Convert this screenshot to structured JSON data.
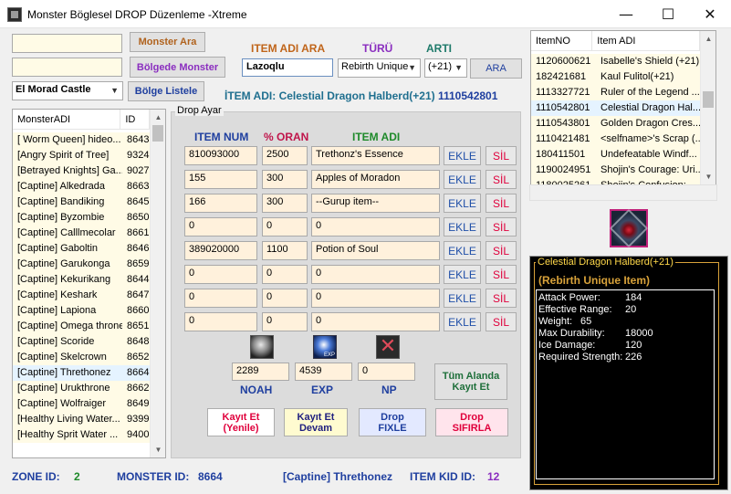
{
  "window": {
    "title": "Monster Böglesel DROP Düzenleme -Xtreme",
    "minimize": "—",
    "maximize": "☐",
    "close": "✕"
  },
  "search": {
    "input1": "",
    "input2": "",
    "monster_ara": "Monster Ara",
    "bolgede_monster": "Bölgede Monster",
    "zone_select": "El Morad Castle",
    "bolge_listele": "Bölge Listele"
  },
  "item_search": {
    "label": "ITEM ADI ARA",
    "value": "Lazoqlu",
    "turu_label": "TÜRÜ",
    "turu_value": "Rebirth Unique",
    "arti_label": "ARTI",
    "arti_value": "(+21)",
    "ara_button": "ARA"
  },
  "item_name_line": {
    "prefix": "İTEM ADI:",
    "name": "Celestial Dragon Halberd(+21)",
    "id": "1110542801"
  },
  "monster_list": {
    "headers": [
      "MonsterADI",
      "ID"
    ],
    "rows": [
      [
        "[ Worm Queen] hideo...",
        "8643"
      ],
      [
        "[Angry Spirit of Tree]",
        "9324"
      ],
      [
        "[Betrayed Knights] Ga...",
        "9027"
      ],
      [
        "[Captine] Alkedrada",
        "8663"
      ],
      [
        "[Captine] Bandiking",
        "8645"
      ],
      [
        "[Captine] Byzombie",
        "8650"
      ],
      [
        "[Captine] Calllmecolar",
        "8661"
      ],
      [
        "[Captine] Gaboltin",
        "8646"
      ],
      [
        "[Captine] Garukonga",
        "8659"
      ],
      [
        "[Captine] Kekurikang",
        "8644"
      ],
      [
        "[Captine] Keshark",
        "8647"
      ],
      [
        "[Captine] Lapiona",
        "8660"
      ],
      [
        "[Captine] Omega throne",
        "8651"
      ],
      [
        "[Captine] Scoride",
        "8648"
      ],
      [
        "[Captine] Skelcrown",
        "8652"
      ],
      [
        "[Captine] Threthonez",
        "8664"
      ],
      [
        "[Captine] Urukthrone",
        "8662"
      ],
      [
        "[Captine] Wolfraiger",
        "8649"
      ],
      [
        "[Healthy Living Water...",
        "9399"
      ],
      [
        "[Healthy Sprit Water ...",
        "9400"
      ]
    ],
    "selected_index": 15
  },
  "drop": {
    "group_label": "Drop Ayar",
    "col_num": "ITEM NUM",
    "col_oran": "% ORAN",
    "col_adi": "ITEM ADI",
    "ekle": "EKLE",
    "sil": "SİL",
    "rows": [
      [
        "810093000",
        "2500",
        "Trethonz's Essence"
      ],
      [
        "155",
        "300",
        "Apples of Moradon"
      ],
      [
        "166",
        "300",
        "--Gurup item--"
      ],
      [
        "0",
        "0",
        "0"
      ],
      [
        "389020000",
        "1100",
        "Potion of Soul"
      ],
      [
        "0",
        "0",
        "0"
      ],
      [
        "0",
        "0",
        "0"
      ],
      [
        "0",
        "0",
        "0"
      ]
    ],
    "noah_value": "2289",
    "exp_value": "4539",
    "np_value": "0",
    "noah_label": "NOAH",
    "exp_label": "EXP",
    "np_label": "NP",
    "tum_alanda_1": "Tüm Alanda",
    "tum_alanda_2": "Kayıt Et",
    "kayit_yenile_1": "Kayıt Et",
    "kayit_yenile_2": "(Yenile)",
    "kayit_devam_1": "Kayıt Et",
    "kayit_devam_2": "Devam",
    "drop_fixle_1": "Drop",
    "drop_fixle_2": "FIXLE",
    "drop_sifirla_1": "Drop",
    "drop_sifirla_2": "SIFIRLA"
  },
  "item_list": {
    "headers": [
      "ItemNO",
      "Item ADI"
    ],
    "rows": [
      [
        "1120600621",
        "Isabelle's Shield (+21)"
      ],
      [
        "182421681",
        "Kaul Fulitol(+21)"
      ],
      [
        "1113327721",
        "Ruler of the Legend ..."
      ],
      [
        "1110542801",
        "Celestial Dragon Hal..."
      ],
      [
        "1110543801",
        "Golden Dragon Cres..."
      ],
      [
        "1110421481",
        "<selfname>'s Scrap (..."
      ],
      [
        "180411501",
        "Undefeatable Windf..."
      ],
      [
        "1190024951",
        "Shojin's Courage: Uri..."
      ],
      [
        "1180025261",
        "Shojin's Confusion:..."
      ]
    ],
    "selected_index": 3
  },
  "info": {
    "title": "Celestial Dragon Halberd(+21)",
    "type": "(Rebirth Unique Item)",
    "stats": [
      [
        "Attack Power:",
        "184"
      ],
      [
        "Effective Range:",
        "20"
      ],
      [
        "Weight:",
        "65"
      ],
      [
        "Max Durability:",
        "18000"
      ],
      [
        "Ice Damage:",
        "120"
      ],
      [
        "Required Strength:",
        "226"
      ]
    ]
  },
  "status": {
    "zone_label": "ZONE ID:",
    "zone_value": "2",
    "monster_label": "MONSTER  ID:",
    "monster_value": "8664",
    "monster_name": "[Captine] Threthonez",
    "kid_label": "ITEM KID ID:",
    "kid_value": "12"
  },
  "colors": {
    "label_orange": "#c0651a",
    "label_purple": "#8a2dbf",
    "label_blue": "#1f3f9f",
    "label_green": "#1e8a2a",
    "label_red": "#e0003c",
    "info_gold": "#d8a23a"
  }
}
